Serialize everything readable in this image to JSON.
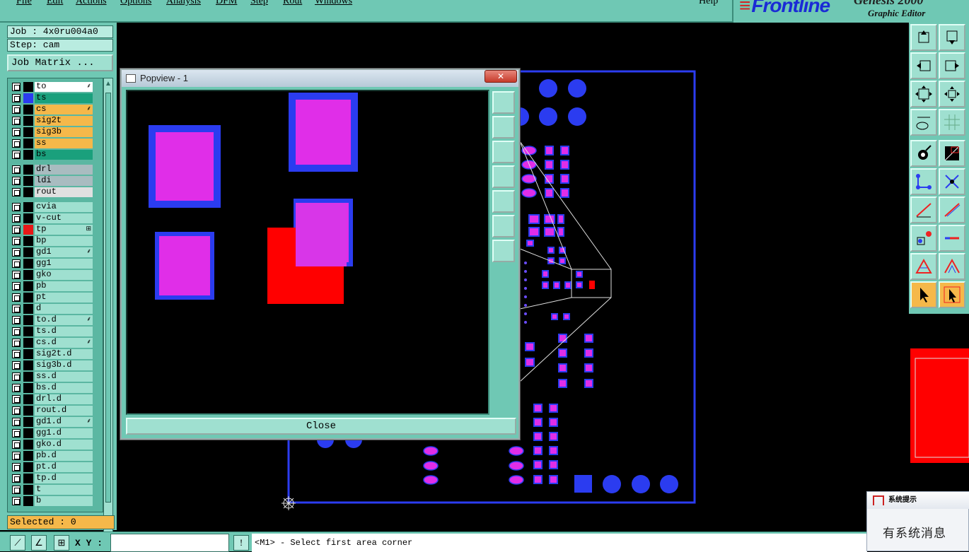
{
  "menu": {
    "items": [
      "File",
      "Edit",
      "Actions",
      "Options",
      "Analysis",
      "DFM",
      "Step",
      "Rout",
      "Windows"
    ],
    "help": "Help"
  },
  "brand": {
    "logo": "Frontline",
    "product": "Genesis 2000",
    "subtitle": "Graphic Editor"
  },
  "job": {
    "job_label": "Job : 4x0ru004a0",
    "step_label": "Step: cam",
    "matrix_button": "Job Matrix ..."
  },
  "layers": [
    {
      "name": "to",
      "color": "#ffffff",
      "swatch": "#000000",
      "flag": "⸙"
    },
    {
      "name": "ts",
      "color": "#1aa07c",
      "swatch": "#2b3cf0",
      "flag": ""
    },
    {
      "name": "cs",
      "color": "#f5b84a",
      "swatch": "#000000",
      "flag": "⸙"
    },
    {
      "name": "sig2t",
      "color": "#f5b84a",
      "swatch": "#000000",
      "flag": ""
    },
    {
      "name": "sig3b",
      "color": "#f5b84a",
      "swatch": "#000000",
      "flag": ""
    },
    {
      "name": "ss",
      "color": "#f5b84a",
      "swatch": "#000000",
      "flag": ""
    },
    {
      "name": "bs",
      "color": "#1aa07c",
      "swatch": "#000000",
      "flag": ""
    },
    {
      "name": "drl",
      "color": "#a9bcc0",
      "swatch": "#000000",
      "flag": ""
    },
    {
      "name": "ldi",
      "color": "#a9bcc0",
      "swatch": "#000000",
      "flag": ""
    },
    {
      "name": "rout",
      "color": "#e0e0e0",
      "swatch": "#000000",
      "flag": ""
    },
    {
      "name": "cvia",
      "color": "#9fe0d0",
      "swatch": "#000000",
      "flag": ""
    },
    {
      "name": "v-cut",
      "color": "#9fe0d0",
      "swatch": "#000000",
      "flag": ""
    },
    {
      "name": "tp",
      "color": "#9fe0d0",
      "swatch": "#e81818",
      "flag": "⊞"
    },
    {
      "name": "bp",
      "color": "#9fe0d0",
      "swatch": "#000000",
      "flag": ""
    },
    {
      "name": "gd1",
      "color": "#9fe0d0",
      "swatch": "#000000",
      "flag": "⸙"
    },
    {
      "name": "gg1",
      "color": "#9fe0d0",
      "swatch": "#000000",
      "flag": ""
    },
    {
      "name": "gko",
      "color": "#9fe0d0",
      "swatch": "#000000",
      "flag": ""
    },
    {
      "name": "pb",
      "color": "#9fe0d0",
      "swatch": "#000000",
      "flag": ""
    },
    {
      "name": "pt",
      "color": "#9fe0d0",
      "swatch": "#000000",
      "flag": ""
    },
    {
      "name": "d",
      "color": "#9fe0d0",
      "swatch": "#000000",
      "flag": ""
    },
    {
      "name": "to.d",
      "color": "#9fe0d0",
      "swatch": "#000000",
      "flag": "⸙"
    },
    {
      "name": "ts.d",
      "color": "#9fe0d0",
      "swatch": "#000000",
      "flag": ""
    },
    {
      "name": "cs.d",
      "color": "#9fe0d0",
      "swatch": "#000000",
      "flag": "⸙"
    },
    {
      "name": "sig2t.d",
      "color": "#9fe0d0",
      "swatch": "#000000",
      "flag": ""
    },
    {
      "name": "sig3b.d",
      "color": "#9fe0d0",
      "swatch": "#000000",
      "flag": ""
    },
    {
      "name": "ss.d",
      "color": "#9fe0d0",
      "swatch": "#000000",
      "flag": ""
    },
    {
      "name": "bs.d",
      "color": "#9fe0d0",
      "swatch": "#000000",
      "flag": ""
    },
    {
      "name": "drl.d",
      "color": "#9fe0d0",
      "swatch": "#000000",
      "flag": ""
    },
    {
      "name": "rout.d",
      "color": "#9fe0d0",
      "swatch": "#000000",
      "flag": ""
    },
    {
      "name": "gd1.d",
      "color": "#9fe0d0",
      "swatch": "#000000",
      "flag": "⸙"
    },
    {
      "name": "gg1.d",
      "color": "#9fe0d0",
      "swatch": "#000000",
      "flag": ""
    },
    {
      "name": "gko.d",
      "color": "#9fe0d0",
      "swatch": "#000000",
      "flag": ""
    },
    {
      "name": "pb.d",
      "color": "#9fe0d0",
      "swatch": "#000000",
      "flag": ""
    },
    {
      "name": "pt.d",
      "color": "#9fe0d0",
      "swatch": "#000000",
      "flag": ""
    },
    {
      "name": "tp.d",
      "color": "#9fe0d0",
      "swatch": "#000000",
      "flag": ""
    },
    {
      "name": "t",
      "color": "#9fe0d0",
      "swatch": "#000000",
      "flag": ""
    },
    {
      "name": "b",
      "color": "#9fe0d0",
      "swatch": "#000000",
      "flag": ""
    }
  ],
  "selected": "Selected : 0",
  "popview": {
    "title": "Popview - 1",
    "close_x": "✕",
    "close_button": "Close"
  },
  "statusbar": {
    "xy_label": "X Y :",
    "xy_value": "",
    "prompt": "<M1> - Select first area corner"
  },
  "notification": {
    "title": "系统提示",
    "body": "有系统消息"
  },
  "colors": {
    "panel": "#6fc8b4",
    "pad": "#e02ee8",
    "copper": "#2b3cf0",
    "highlight": "#ff0000"
  }
}
